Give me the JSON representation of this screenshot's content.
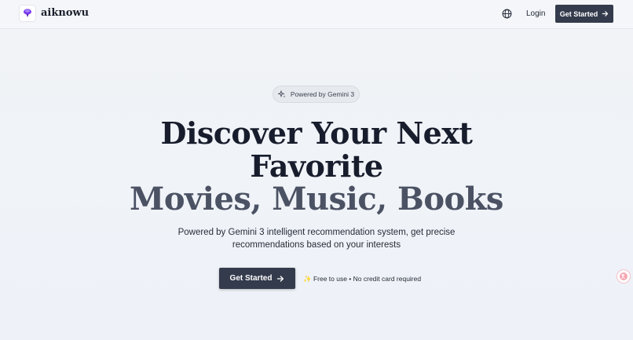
{
  "header": {
    "brand": "aiknowu",
    "logo_icon": "logo-icon",
    "language_icon": "globe-icon",
    "login_label": "Login",
    "get_started_label": "Get Started"
  },
  "hero": {
    "badge_label": "Powered by Gemini 3",
    "badge_icon": "sparkle-icon",
    "title_line1": "Discover Your Next",
    "title_line2": "Favorite",
    "title_line3": "Movies, Music, Books",
    "subtitle_line1": "Powered by Gemini 3 intelligent recommendation system, get precise",
    "subtitle_line2": "recommendations based on your interests",
    "cta_label": "Get Started",
    "note": "✨ Free to use • No credit card required"
  },
  "floating": {
    "translate_icon": "translate-icon"
  },
  "colors": {
    "primary_button": "#343b4c",
    "title": "#181d2d",
    "title_accent": "#4b5264",
    "logo": "#7c3aed"
  }
}
